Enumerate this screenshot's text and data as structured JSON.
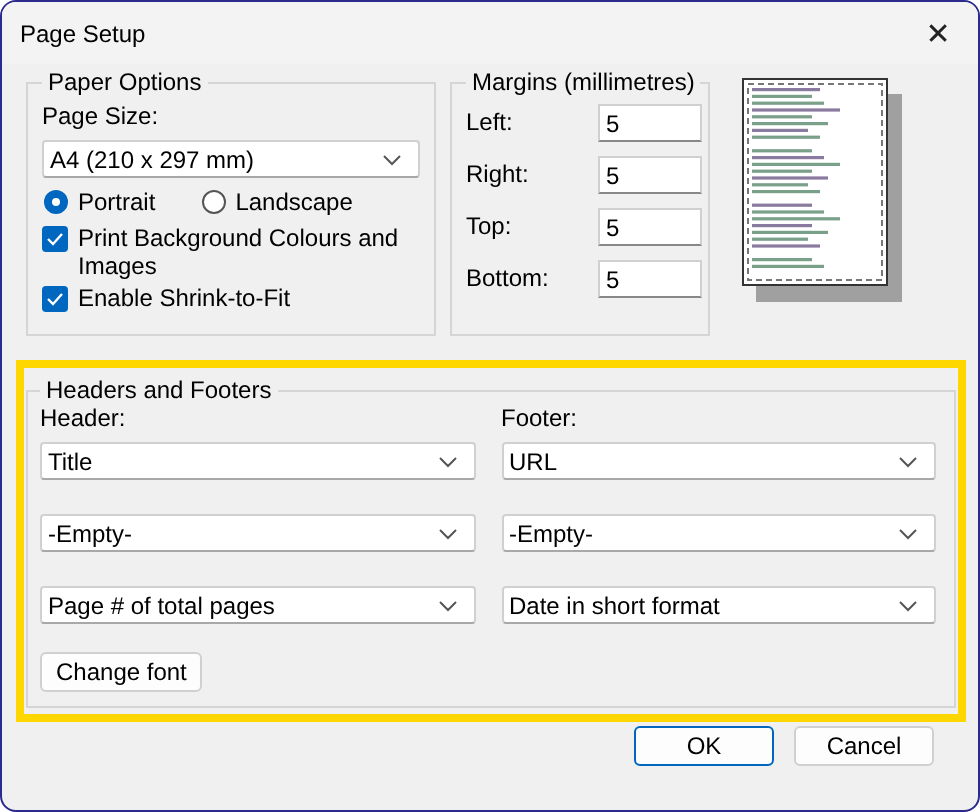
{
  "window": {
    "title": "Page Setup",
    "close": "✕"
  },
  "paper_options": {
    "title": "Paper Options",
    "page_size_label": "Page Size:",
    "page_size": "A4 (210 x 297 mm)",
    "orientation": [
      {
        "label": "Portrait",
        "selected": true
      },
      {
        "label": "Landscape",
        "selected": false
      }
    ],
    "checkboxes": [
      {
        "label": "Print Background Colours and Images",
        "checked": true
      },
      {
        "label": "Enable Shrink-to-Fit",
        "checked": true
      }
    ]
  },
  "margins": {
    "title": "Margins (millimetres)",
    "fields": [
      {
        "label": "Left:",
        "value": "5"
      },
      {
        "label": "Right:",
        "value": "5"
      },
      {
        "label": "Top:",
        "value": "5"
      },
      {
        "label": "Bottom:",
        "value": "5"
      }
    ]
  },
  "headers_footers": {
    "title": "Headers and Footers",
    "header_label": "Header:",
    "footer_label": "Footer:",
    "header": [
      "Title",
      "-Empty-",
      "Page # of total pages"
    ],
    "footer": [
      "URL",
      "-Empty-",
      "Date in short format"
    ],
    "change_font": "Change font"
  },
  "buttons": [
    {
      "label": "OK",
      "default": true
    },
    {
      "label": "Cancel",
      "default": false
    }
  ]
}
